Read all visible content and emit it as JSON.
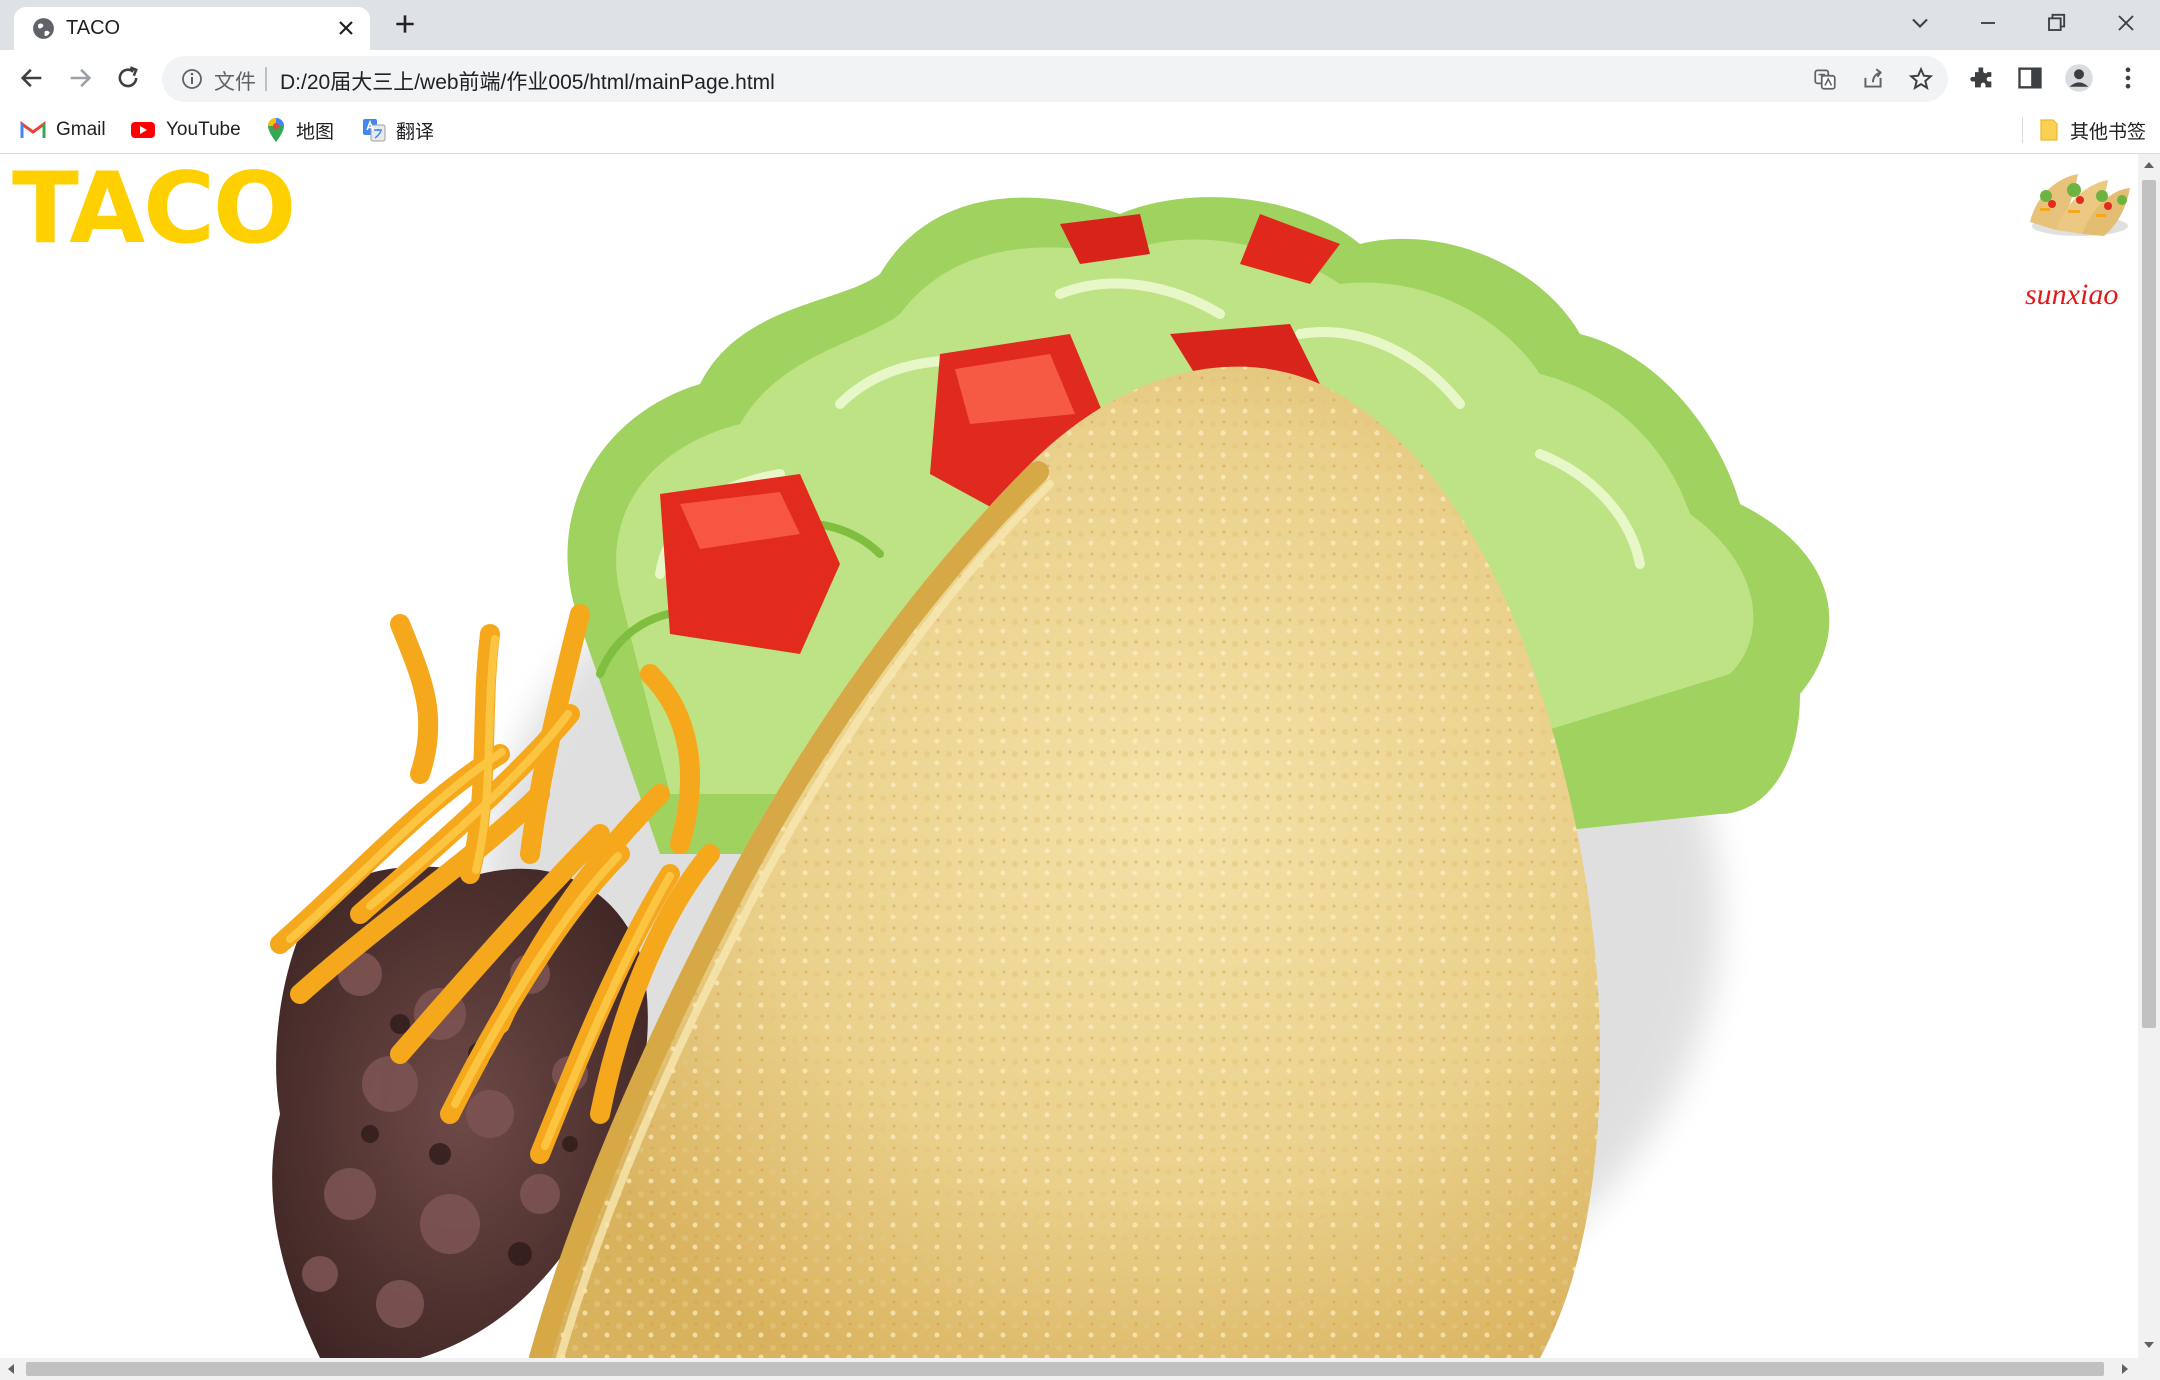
{
  "tab": {
    "title": "TACO"
  },
  "omnibox": {
    "scheme_label": "文件",
    "url": "D:/20届大三上/web前端/作业005/html/mainPage.html"
  },
  "bookmarks": {
    "items": [
      {
        "label": "Gmail",
        "icon": "gmail-icon"
      },
      {
        "label": "YouTube",
        "icon": "youtube-icon"
      },
      {
        "label": "地图",
        "icon": "maps-icon"
      },
      {
        "label": "翻译",
        "icon": "translate-icon"
      }
    ],
    "other_label": "其他书签"
  },
  "page": {
    "title": "TACO",
    "author": "sunxiao",
    "title_color": "#ffd000",
    "author_color": "#e11b1b"
  }
}
